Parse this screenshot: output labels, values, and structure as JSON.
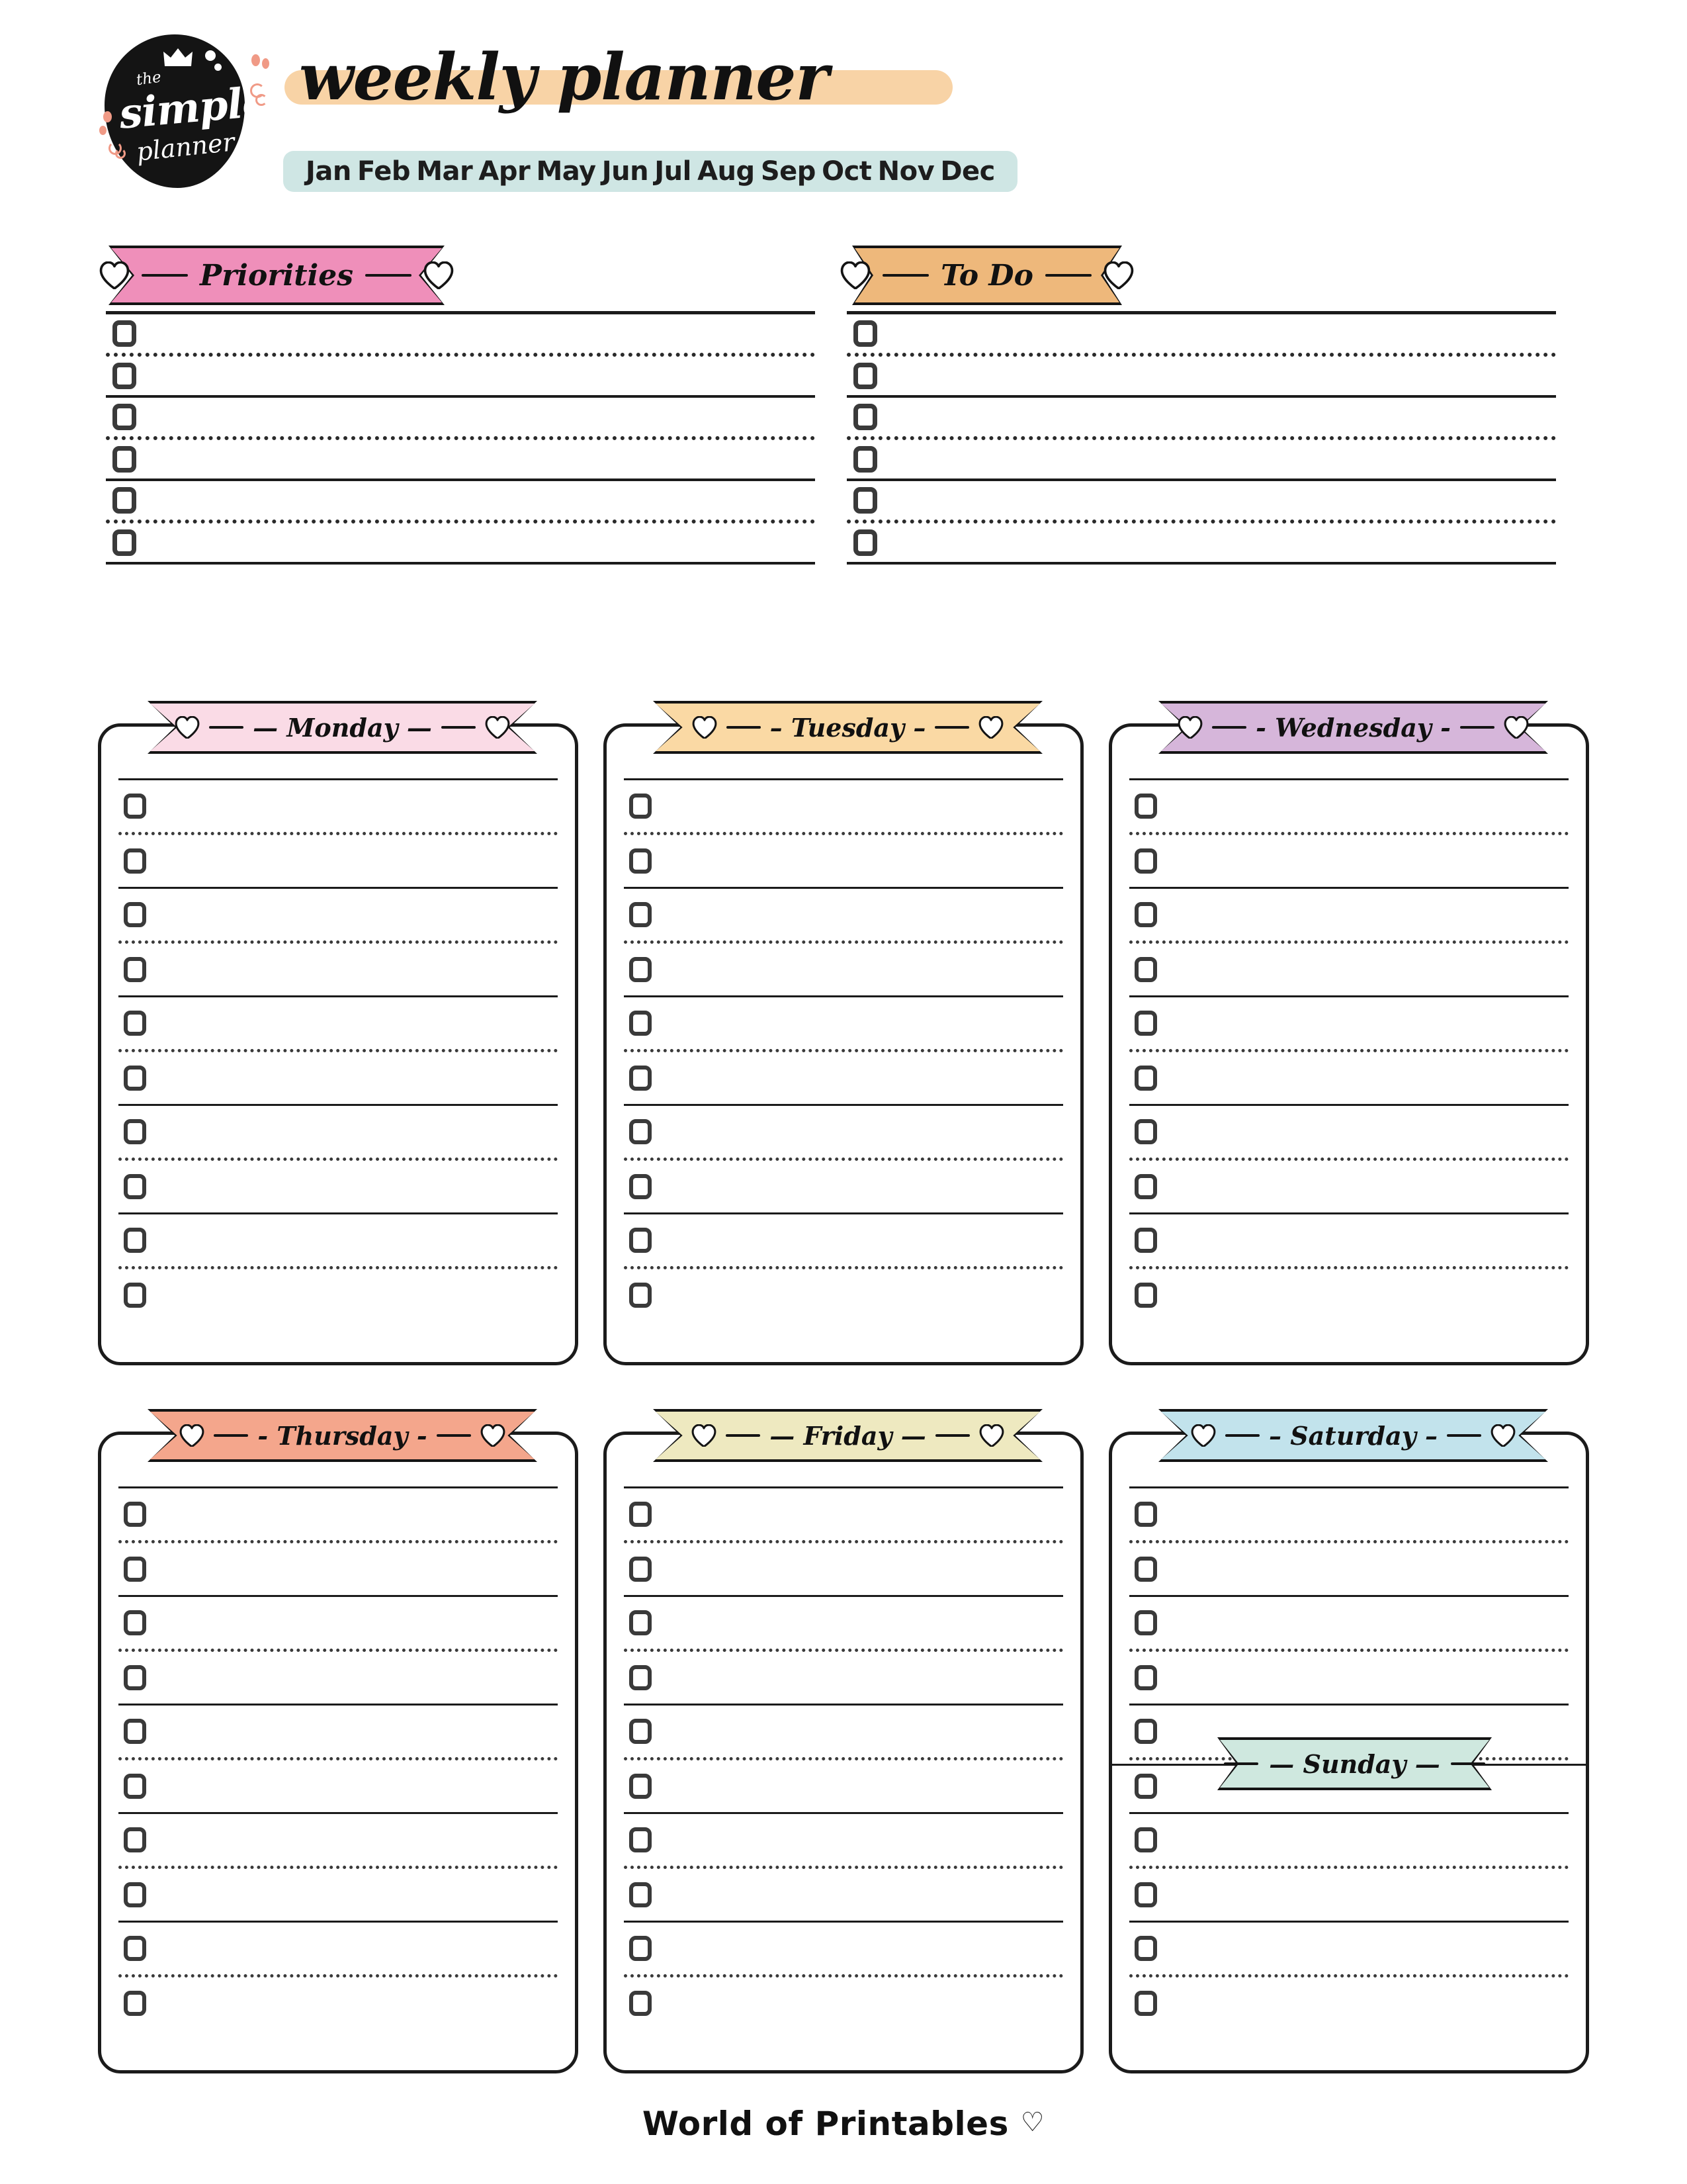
{
  "header": {
    "logo": {
      "the": "the",
      "simple": "simple",
      "planner": "planner",
      "crown_icon": "crown-icon"
    },
    "title": "weekly planner",
    "months": [
      "Jan",
      "Feb",
      "Mar",
      "Apr",
      "May",
      "Jun",
      "Jul",
      "Aug",
      "Sep",
      "Oct",
      "Nov",
      "Dec"
    ]
  },
  "top_sections": [
    {
      "id": "priorities",
      "label": "Priorities",
      "color": "#ef8fba",
      "has_hearts": true,
      "rows": 6,
      "separators": [
        "dotted",
        "solid",
        "dotted",
        "solid",
        "dotted"
      ]
    },
    {
      "id": "todo",
      "label": "To Do",
      "color": "#eeb87b",
      "has_hearts": true,
      "rows": 6,
      "separators": [
        "dotted",
        "solid",
        "dotted",
        "solid",
        "dotted"
      ]
    }
  ],
  "days": [
    {
      "id": "monday",
      "label": "Monday",
      "color": "#fadbe6",
      "dash": "—",
      "rows": 10
    },
    {
      "id": "tuesday",
      "label": "Tuesday",
      "color": "#fad9a4",
      "dash": "–",
      "rows": 10
    },
    {
      "id": "wednesday",
      "label": "Wednesday",
      "color": "#d6b6da",
      "dash": "-",
      "rows": 10
    },
    {
      "id": "thursday",
      "label": "Thursday",
      "color": "#f4a68c",
      "dash": "-",
      "rows": 10
    },
    {
      "id": "friday",
      "label": "Friday",
      "color": "#eee9c0",
      "dash": "—",
      "rows": 10
    },
    {
      "id": "saturday",
      "label": "Saturday",
      "color": "#c2e3ec",
      "dash": "–",
      "rows": 10
    }
  ],
  "sunday": {
    "id": "sunday",
    "label": "Sunday",
    "color": "#cfe8df",
    "dash": "—",
    "has_hearts": false,
    "after_row": 5
  },
  "footer": {
    "text": "World of Printables",
    "heart_icon": "heart-icon"
  },
  "colors": {
    "ink": "#1b1b1b",
    "checkbox_stroke": "#3a3a3a",
    "title_highlight": "#f8d3a6",
    "months_pill": "#cfe6e4",
    "logo_blob": "#141414",
    "accent_coral": "#f09a86"
  }
}
